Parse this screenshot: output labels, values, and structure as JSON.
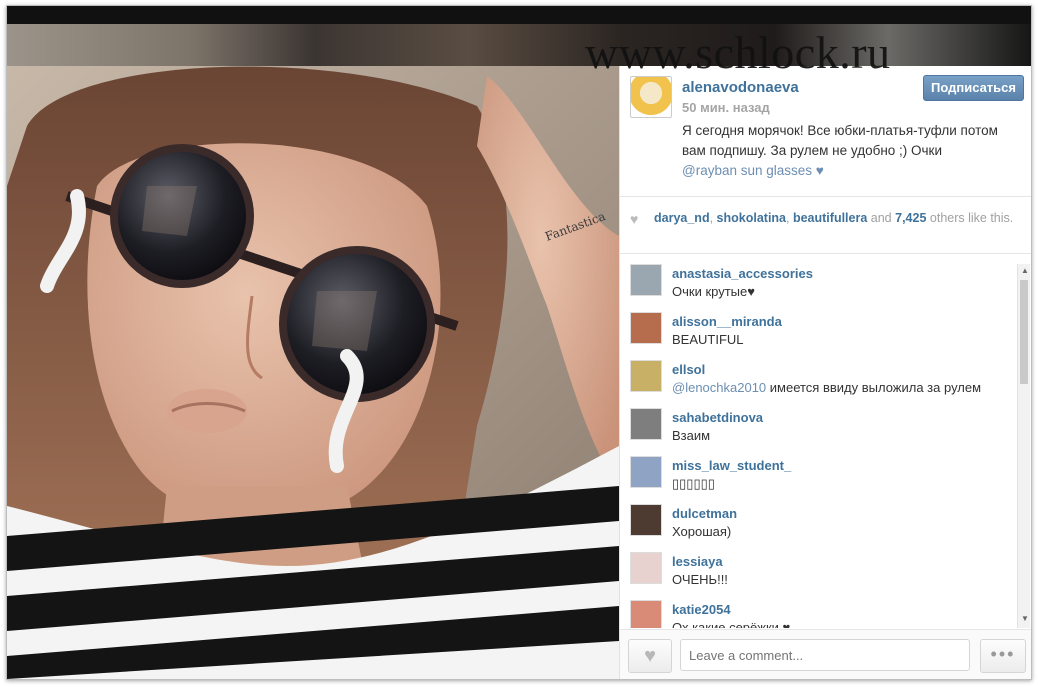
{
  "watermark": "www.schlock.ru",
  "post": {
    "username": "alenavodonaeva",
    "time": "50 мин. назад",
    "follow_label": "Подписаться",
    "caption": "Я сегодня морячок! Все юбки-платья-туфли потом вам подпишу. За рулем не удобно ;) Очки",
    "caption_tags": "@rayban  sun  glasses ♥"
  },
  "likes": {
    "user1": "darya_nd",
    "user2": "shokolatina",
    "user3": "beautifullera",
    "and_text": "and",
    "count": "7,425",
    "suffix": "others like this."
  },
  "comments": [
    {
      "user": "anastasia_accessories",
      "text": "Очки крутые♥",
      "color": "#9aa7b0"
    },
    {
      "user": "alisson__miranda",
      "text": "BEAUTIFUL",
      "color": "#b56d4e"
    },
    {
      "user": "ellsol",
      "mention": "@lenochka2010",
      "text": " имеется ввиду выложила за рулем",
      "color": "#c9b067"
    },
    {
      "user": "sahabetdinova",
      "text": "Взаим",
      "color": "#7e7e7e"
    },
    {
      "user": "miss_law_student_",
      "text": "▯▯▯▯▯▯",
      "color": "#8fa4c4"
    },
    {
      "user": "dulcetman",
      "text": "Хорошая)",
      "color": "#4d3a30"
    },
    {
      "user": "lessiaya",
      "text": "ОЧЕНЬ!!!",
      "color": "#e8d2cf"
    },
    {
      "user": "katie2054",
      "text": "Ох какие серёжки ♥",
      "color": "#d98b77"
    }
  ],
  "footer": {
    "comment_placeholder": "Leave a comment...",
    "more_label": "•••"
  }
}
